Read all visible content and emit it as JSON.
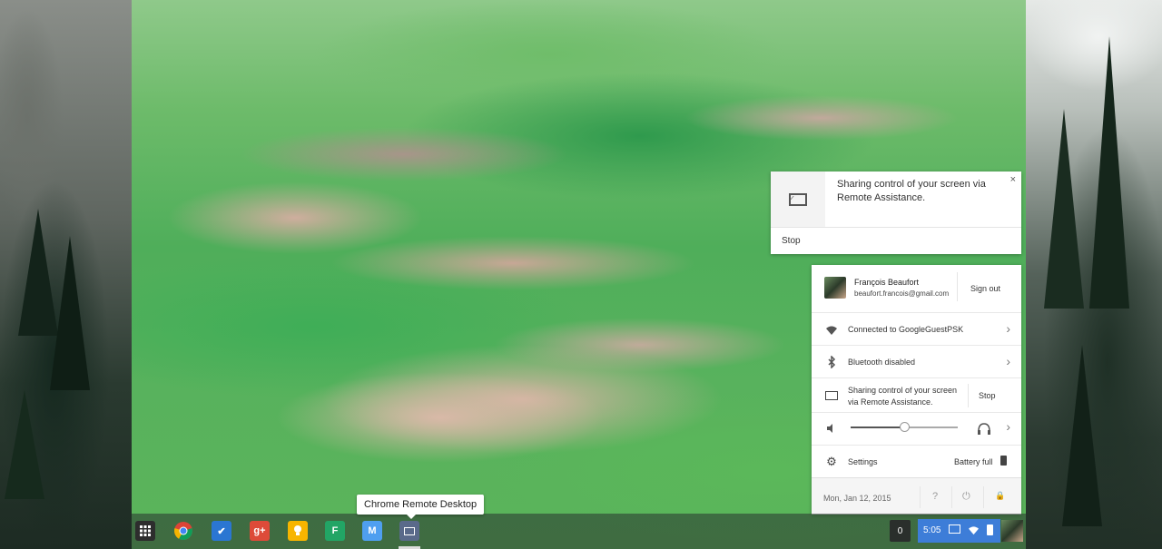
{
  "shelf": {
    "apps": [
      {
        "name": "launcher-icon",
        "label": "",
        "bg": "#2d2d2d",
        "glyph": "▦"
      },
      {
        "name": "chrome-icon",
        "label": "",
        "bg": "transparent",
        "glyph": ""
      },
      {
        "name": "tasks-icon",
        "label": "",
        "bg": "#2b76d2",
        "glyph": "✔"
      },
      {
        "name": "google-plus-icon",
        "label": "g+",
        "bg": "#dd4b39",
        "glyph": ""
      },
      {
        "name": "keep-icon",
        "label": "",
        "bg": "#f7b500",
        "glyph": "💡"
      },
      {
        "name": "sheets-icon",
        "label": "F",
        "bg": "#22a565",
        "glyph": ""
      },
      {
        "name": "gmail-icon",
        "label": "M",
        "bg": "#4f9ff0",
        "glyph": ""
      },
      {
        "name": "remote-desktop-icon",
        "label": "",
        "bg": "#5a6a8a",
        "glyph": "▭"
      }
    ],
    "tooltip": "Chrome Remote Desktop"
  },
  "notification": {
    "message": "Sharing control of your screen via Remote Assistance.",
    "close": "×",
    "stop": "Stop"
  },
  "tray": {
    "user_name": "François Beaufort",
    "user_email": "beaufort.francois@gmail.com",
    "sign_out": "Sign out",
    "network": "Connected to GoogleGuestPSK",
    "bluetooth": "Bluetooth disabled",
    "sharing": "Sharing control of your screen via Remote Assistance.",
    "sharing_stop": "Stop",
    "volume_level": 0.5,
    "settings": "Settings",
    "battery": "Battery full",
    "date": "Mon, Jan 12, 2015",
    "help": "?",
    "power": "⏻",
    "lock": "🔒"
  },
  "status": {
    "notification_count": "0",
    "time": "5:05"
  },
  "colors": {
    "status_blue": "#3d7dd8",
    "shelf_bg": "rgba(40,50,45,0.55)"
  }
}
